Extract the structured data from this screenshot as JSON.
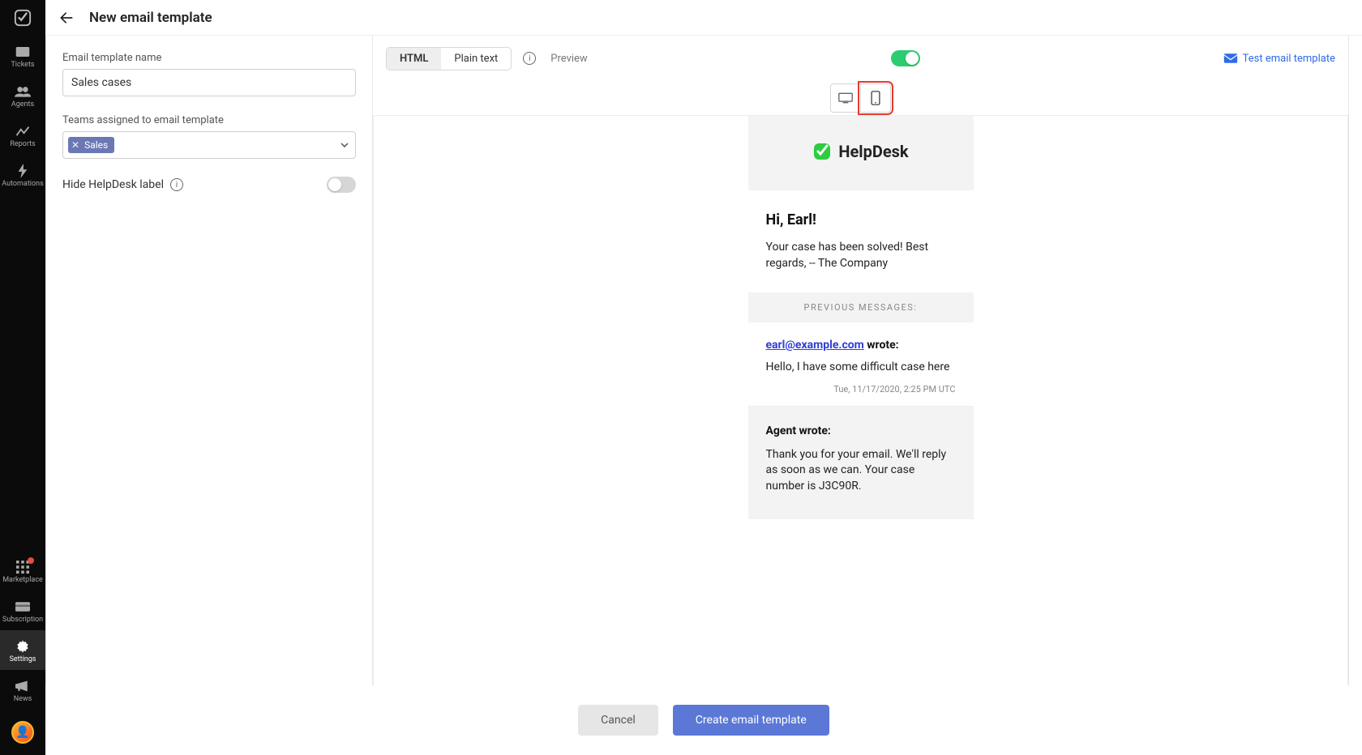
{
  "header": {
    "title": "New email template"
  },
  "sidebar": {
    "items": [
      {
        "label": "Tickets"
      },
      {
        "label": "Agents"
      },
      {
        "label": "Reports"
      },
      {
        "label": "Automations"
      },
      {
        "label": "Marketplace"
      },
      {
        "label": "Subscription"
      },
      {
        "label": "Settings"
      },
      {
        "label": "News"
      }
    ]
  },
  "form": {
    "name_label": "Email template name",
    "name_value": "Sales cases",
    "teams_label": "Teams assigned to email template",
    "team_chip": "Sales",
    "hide_label": "Hide HelpDesk label",
    "hide_on": false
  },
  "toolbar": {
    "seg_html": "HTML",
    "seg_plain": "Plain text",
    "preview_label": "Preview",
    "preview_on": true,
    "test_link": "Test email template"
  },
  "preview": {
    "brand": "HelpDesk",
    "greeting": "Hi, Earl!",
    "body": "Your case has been solved! Best regards, -- The Company",
    "prev_label": "PREVIOUS MESSAGES:",
    "msg1_email": "earl@example.com",
    "wrote": " wrote:",
    "msg1_body": "Hello, I have some difficult case here",
    "msg1_ts": "Tue, 11/17/2020, 2:25 PM UTC",
    "agent_label": "Agent wrote:",
    "agent_body": "Thank you for your email. We'll reply as soon as we can. Your case number is J3C90R."
  },
  "footer": {
    "cancel": "Cancel",
    "create": "Create email template"
  }
}
